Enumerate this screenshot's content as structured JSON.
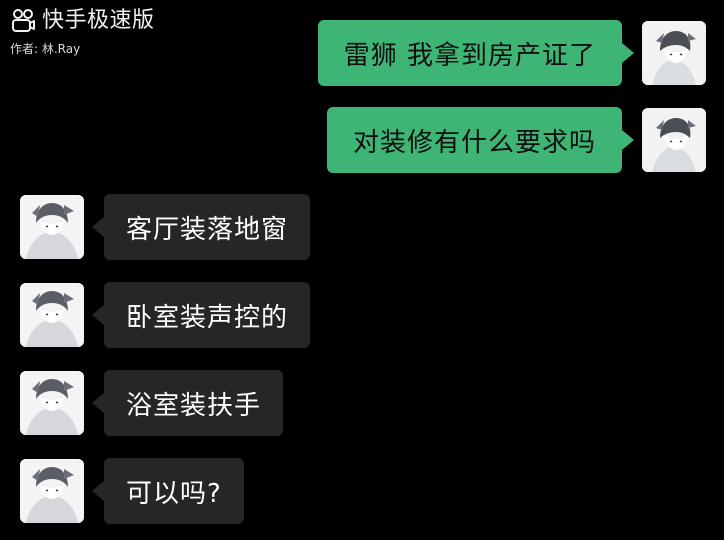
{
  "watermark": {
    "app_name": "快手极速版",
    "author": "作者: 林.Ray",
    "logo_icon": "kuaishou-logo-icon"
  },
  "colors": {
    "background": "#000000",
    "sent_bubble": "#3eb575",
    "received_bubble": "#262626",
    "received_text": "#ffffff"
  },
  "chat": {
    "messages": [
      {
        "side": "right",
        "sender": "me",
        "text": "雷狮 我拿到房产证了"
      },
      {
        "side": "right",
        "sender": "me",
        "text": "对装修有什么要求吗"
      },
      {
        "side": "left",
        "sender": "other",
        "text": "客厅装落地窗"
      },
      {
        "side": "left",
        "sender": "other",
        "text": "卧室装声控的"
      },
      {
        "side": "left",
        "sender": "other",
        "text": "浴室装扶手"
      },
      {
        "side": "left",
        "sender": "other",
        "text": "可以吗?"
      }
    ]
  }
}
